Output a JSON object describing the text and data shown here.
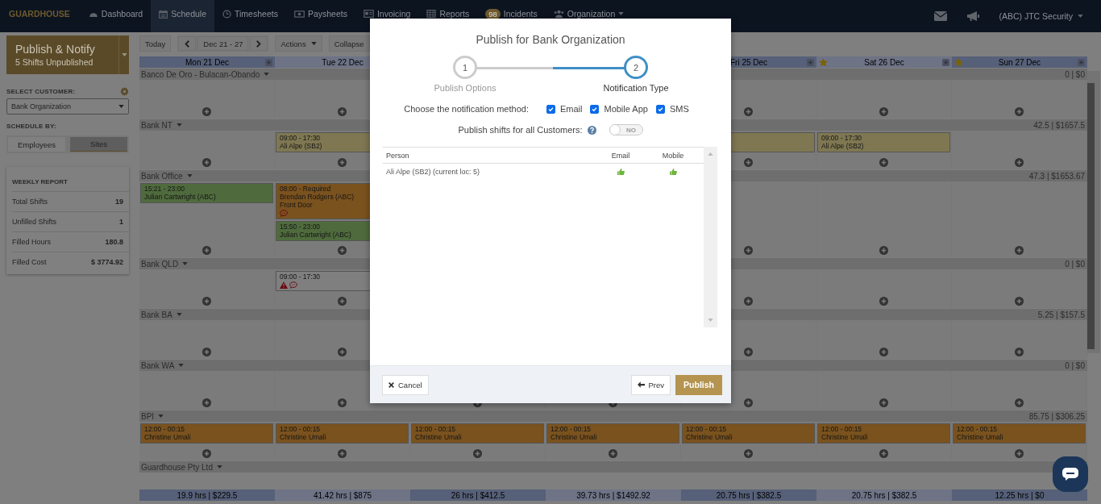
{
  "nav": {
    "logo": "GUARDHOUSE",
    "items": [
      {
        "label": "Dashboard",
        "selected": false
      },
      {
        "label": "Schedule",
        "selected": true
      },
      {
        "label": "Timesheets",
        "selected": false
      },
      {
        "label": "Paysheets",
        "selected": false
      },
      {
        "label": "Invoicing",
        "selected": false
      },
      {
        "label": "Reports",
        "selected": false
      },
      {
        "label": "Incidents",
        "badge": "98",
        "selected": false
      },
      {
        "label": "Organization",
        "dropdown": true,
        "selected": false
      }
    ],
    "account": "(ABC) JTC Security"
  },
  "sidebar": {
    "publish_button": {
      "label": "Publish & Notify",
      "sublabel": "5 Shifts Unpublished"
    },
    "customer_label": "SELECT CUSTOMER:",
    "customer_select": "Bank Organization",
    "schedule_by_label": "SCHEDULE BY:",
    "schedule_by_options": [
      {
        "label": "Employees",
        "selected": false
      },
      {
        "label": "Sites",
        "selected": true
      }
    ],
    "weekly_report": {
      "title": "WEEKLY REPORT",
      "rows": [
        {
          "label": "Total Shifts",
          "value": "19"
        },
        {
          "label": "Unfilled Shifts",
          "value": "1"
        },
        {
          "label": "Filled Hours",
          "value": "180.8"
        },
        {
          "label": "Filled Cost",
          "value": "$ 3774.92"
        }
      ]
    }
  },
  "toolbar": {
    "today": "Today",
    "range": "Dec 21 - 27",
    "actions": "Actions",
    "collapse": "Collapse"
  },
  "schedule": {
    "days_left": [
      {
        "label": "Mon 21 Dec",
        "star": false
      },
      {
        "label": "Tue 22 Dec",
        "star": false
      }
    ],
    "days_right": [
      {
        "label": "Fri 25 Dec"
      },
      {
        "label": "Sat 26 Dec",
        "star": true
      },
      {
        "label": "Sun 27 Dec",
        "star": true
      }
    ],
    "sites": [
      {
        "name": "Banco De Oro - Bulacan-Obando",
        "total": "0 | $0",
        "cells": [
          [],
          [],
          [],
          [],
          [],
          [],
          []
        ]
      },
      {
        "name": "Bank NT",
        "total": "42.5 | $1657.5",
        "cells": [
          [],
          [
            {
              "color": "#7f7752",
              "lines": [
                "09:00 - 17:30",
                "Ali Alpe (SB2)"
              ]
            }
          ],
          [],
          [],
          [
            {
              "color": "#7f7752"
            }
          ],
          [
            {
              "color": "#7f7752",
              "lines": [
                "09:00 - 17:30",
                "Ali Alpe (SB2)"
              ]
            }
          ],
          []
        ]
      },
      {
        "name": "Bank Office",
        "total": "47.3 | $1653.67",
        "cells": [
          [
            {
              "color": "#4f6b3d",
              "lines": [
                "15:21 - 23:00",
                "Julian Cartwright (ABC)"
              ]
            }
          ],
          [
            {
              "color": "#7a521e",
              "lines": [
                "08:00 - Required",
                "Brendan Rodgers (ABC)",
                "Front Door"
              ],
              "comment": true
            },
            {
              "color": "#4f6b3d",
              "lines": [
                "15:50 - 23:00",
                "Julian Cartwright (ABC)"
              ]
            }
          ],
          [],
          [],
          [],
          [],
          []
        ]
      },
      {
        "name": "Bank QLD",
        "total": "0 | $0",
        "cells": [
          [],
          [
            {
              "color": "#7f7f7f",
              "lines": [
                "09:00 - 17:30"
              ],
              "warning": true,
              "comment": true
            }
          ],
          [],
          [],
          [],
          [],
          []
        ]
      },
      {
        "name": "Bank BA",
        "total": "5.25 | $157.5",
        "cells": [
          [],
          [],
          [],
          [],
          [],
          [],
          []
        ]
      },
      {
        "name": "Bank WA",
        "total": "0 | $0",
        "cells": [
          [],
          [],
          [],
          [],
          [],
          [],
          []
        ]
      },
      {
        "name": "BPI",
        "total": "85.75 | $306.25",
        "cells": [
          [
            {
              "color": "#7a521e",
              "lines": [
                "12:00 - 00:15",
                "Christine Umali"
              ]
            }
          ],
          [
            {
              "color": "#7a521e",
              "lines": [
                "12:00 - 00:15",
                "Christine Umali"
              ]
            }
          ],
          [
            {
              "color": "#7a521e",
              "lines": [
                "12:00 - 00:15",
                "Christine Umali"
              ]
            }
          ],
          [
            {
              "color": "#7a521e",
              "lines": [
                "12:00 - 00:15",
                "Christine Umali"
              ]
            }
          ],
          [
            {
              "color": "#7a521e",
              "lines": [
                "12:00 - 00:15",
                "Christine Umali"
              ]
            }
          ],
          [
            {
              "color": "#7a521e",
              "lines": [
                "12:00 - 00:15",
                "Christine Umali"
              ]
            }
          ],
          [
            {
              "color": "#7a521e",
              "lines": [
                "12:00 - 00:15",
                "Christine Umali"
              ]
            }
          ]
        ]
      },
      {
        "name": "Guardhouse Pty Ltd"
      }
    ],
    "totals": [
      "19.9 hrs | $229.5",
      "41.42 hrs | $875",
      "26 hrs | $412.5",
      "39.73 hrs | $1492.92",
      "20.75 hrs | $382.5",
      "20.75 hrs | $382.5",
      "12.25 hrs | $0"
    ]
  },
  "modal": {
    "title": "Publish for Bank Organization",
    "steps": [
      {
        "number": "1",
        "label": "Publish Options",
        "selected": false
      },
      {
        "number": "2",
        "label": "Notification Type",
        "selected": true
      }
    ],
    "method_label": "Choose the notification method:",
    "methods": [
      {
        "label": "Email",
        "checked": true
      },
      {
        "label": "Mobile App",
        "checked": true
      },
      {
        "label": "SMS",
        "checked": true
      }
    ],
    "all_customers_label": "Publish shifts for all Customers:",
    "all_customers_toggle": {
      "on": false,
      "label": "NO"
    },
    "table": {
      "columns": [
        "Person",
        "Email",
        "Mobile"
      ],
      "rows": [
        {
          "person": "Ali Alpe (SB2) (current loc: 5)",
          "email": true,
          "mobile": true
        }
      ]
    },
    "buttons": {
      "cancel": "Cancel",
      "prev": "Prev",
      "publish": "Publish"
    }
  }
}
